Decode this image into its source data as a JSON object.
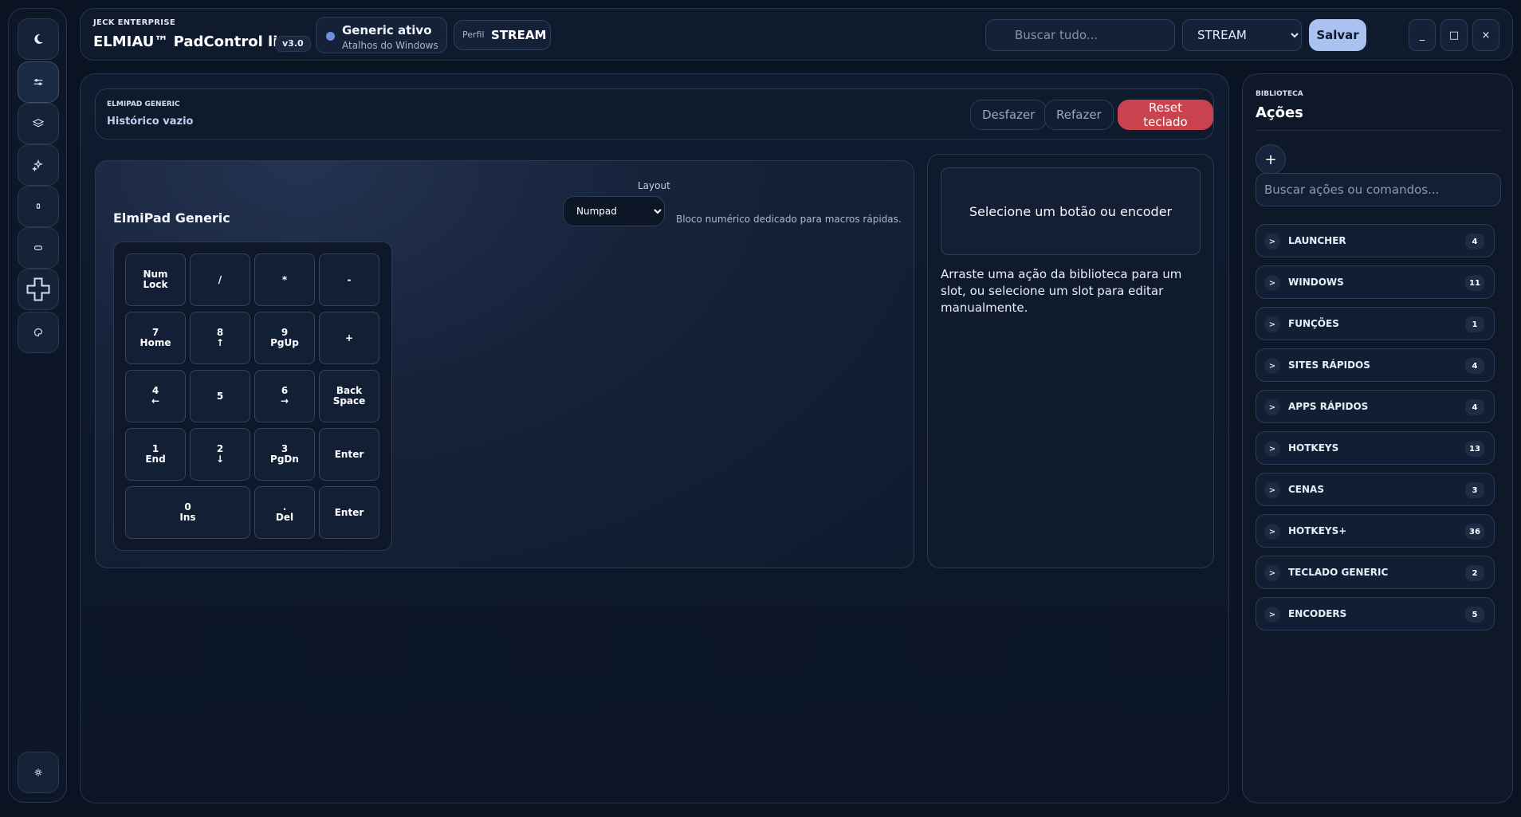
{
  "topbar": {
    "company": "JECK ENTERPRISE",
    "app_title": "ELMIAU™ PadControl lite",
    "version": "v3.0",
    "status_title": "Generic ativo",
    "status_sub": "Atalhos do Windows",
    "profile_label": "Perfil",
    "profile_value": "STREAM",
    "search_placeholder": "Buscar tudo...",
    "profile_select": "STREAM",
    "save_label": "Salvar",
    "min_label": "_",
    "max_label": "□",
    "close_label": "×"
  },
  "history": {
    "device": "ELMIPAD GENERIC",
    "status": "Histórico vazio",
    "undo_label": "Desfazer",
    "redo_label": "Refazer",
    "reset_label": "Reset teclado"
  },
  "pad": {
    "title": "ElmiPad Generic",
    "layout_label": "Layout",
    "layout_value": "Numpad",
    "layout_desc": "Bloco numérico dedicado para macros rápidas.",
    "keys": [
      {
        "l1": "Num",
        "l2": "Lock"
      },
      {
        "l1": "/",
        "l2": ""
      },
      {
        "l1": "*",
        "l2": ""
      },
      {
        "l1": "-",
        "l2": ""
      },
      {
        "l1": "7",
        "l2": "Home"
      },
      {
        "l1": "8",
        "l2": "↑"
      },
      {
        "l1": "9",
        "l2": "PgUp"
      },
      {
        "l1": "+",
        "l2": ""
      },
      {
        "l1": "4",
        "l2": "←"
      },
      {
        "l1": "5",
        "l2": ""
      },
      {
        "l1": "6",
        "l2": "→"
      },
      {
        "l1": "Back",
        "l2": "Space"
      },
      {
        "l1": "1",
        "l2": "End"
      },
      {
        "l1": "2",
        "l2": "↓"
      },
      {
        "l1": "3",
        "l2": "PgDn"
      },
      {
        "l1": "Enter",
        "l2": ""
      },
      {
        "l1": "0",
        "l2": "Ins"
      },
      {
        "l1": ".",
        "l2": "Del"
      },
      {
        "l1": "Enter",
        "l2": ""
      }
    ]
  },
  "detail": {
    "box_text": "Selecione um botão ou encoder",
    "hint": "Arraste uma ação da biblioteca para um slot, ou selecione um slot para editar manualmente."
  },
  "library": {
    "section": "BIBLIOTECA",
    "title": "Ações",
    "add_label": "+",
    "search_placeholder": "Buscar ações ou comandos...",
    "chevron": ">",
    "categories": [
      {
        "name": "LAUNCHER",
        "count": "4"
      },
      {
        "name": "WINDOWS",
        "count": "11"
      },
      {
        "name": "FUNÇÕES",
        "count": "1"
      },
      {
        "name": "SITES RÁPIDOS",
        "count": "4"
      },
      {
        "name": "APPS RÁPIDOS",
        "count": "4"
      },
      {
        "name": "HOTKEYS",
        "count": "13"
      },
      {
        "name": "CENAS",
        "count": "3"
      },
      {
        "name": "HOTKEYS+",
        "count": "36"
      },
      {
        "name": "TECLADO GENERIC",
        "count": "2"
      },
      {
        "name": "ENCODERS",
        "count": "5"
      }
    ]
  }
}
